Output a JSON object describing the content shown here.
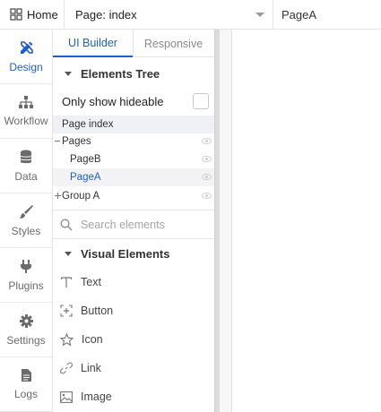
{
  "topbar": {
    "home_label": "Home",
    "page_select_value": "Page: index",
    "current_page": "PageA"
  },
  "leftnav": {
    "items": [
      {
        "label": "Design",
        "icon": "pencil-ruler-icon",
        "active": true
      },
      {
        "label": "Workflow",
        "icon": "sitemap-icon",
        "active": false
      },
      {
        "label": "Data",
        "icon": "database-icon",
        "active": false
      },
      {
        "label": "Styles",
        "icon": "brush-icon",
        "active": false
      },
      {
        "label": "Plugins",
        "icon": "plug-icon",
        "active": false
      },
      {
        "label": "Settings",
        "icon": "gear-icon",
        "active": false
      },
      {
        "label": "Logs",
        "icon": "document-icon",
        "active": false
      }
    ]
  },
  "panel": {
    "tabs": [
      "UI Builder",
      "Responsive"
    ],
    "elements_tree": {
      "title": "Elements Tree",
      "only_show_hideable": "Only show hideable",
      "rows": [
        {
          "label": "Page index"
        },
        {
          "label": "Pages"
        },
        {
          "label": "PageB"
        },
        {
          "label": "PageA"
        },
        {
          "label": "Group A"
        }
      ]
    },
    "search": {
      "placeholder": "Search elements"
    },
    "visual_elements": {
      "title": "Visual Elements",
      "items": [
        {
          "label": "Text",
          "icon": "text-icon"
        },
        {
          "label": "Button",
          "icon": "button-icon"
        },
        {
          "label": "Icon",
          "icon": "star-icon"
        },
        {
          "label": "Link",
          "icon": "link-icon"
        },
        {
          "label": "Image",
          "icon": "image-icon"
        }
      ]
    }
  },
  "colors": {
    "accent": "#1e5cd6",
    "selected_row_bg": "#eff1f6"
  }
}
